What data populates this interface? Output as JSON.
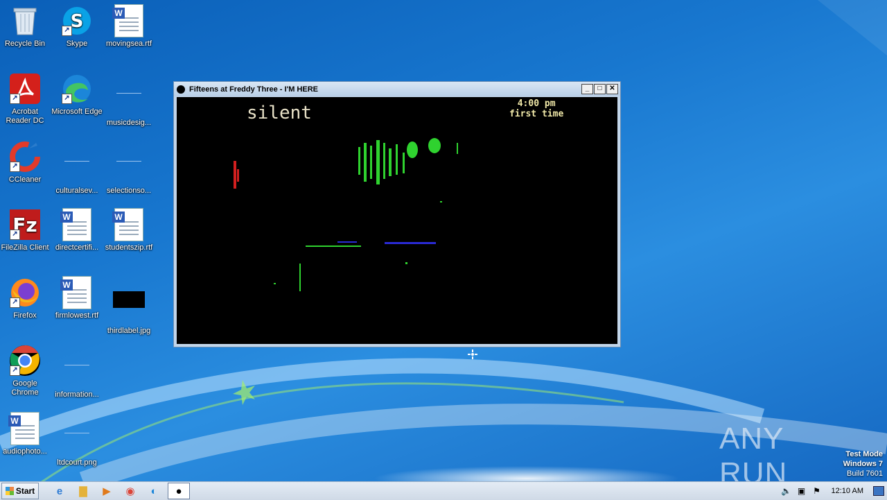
{
  "desktop": {
    "icons": [
      {
        "label": "Recycle Bin"
      },
      {
        "label": "Skype"
      },
      {
        "label": "movingsea.rtf"
      },
      {
        "label": "Acrobat Reader DC"
      },
      {
        "label": "Microsoft Edge"
      },
      {
        "label": "musicdesig..."
      },
      {
        "label": "CCleaner"
      },
      {
        "label": "culturalsev..."
      },
      {
        "label": "selectionso..."
      },
      {
        "label": "FileZilla Client"
      },
      {
        "label": "directcertifi..."
      },
      {
        "label": "studentszip.rtf"
      },
      {
        "label": "Firefox"
      },
      {
        "label": "firmlowest.rtf"
      },
      {
        "label": "thirdlabel.jpg"
      },
      {
        "label": "Google Chrome"
      },
      {
        "label": "information..."
      },
      {
        "label": "audiophoto..."
      },
      {
        "label": "ltdcourt.png"
      }
    ]
  },
  "window": {
    "title": "Fifteens at Freddy Three - I'M HERE",
    "game": {
      "status_text": "silent",
      "clock_time": "4:00 pm",
      "clock_sub": "first time"
    }
  },
  "watermark": {
    "text": "ANY RUN"
  },
  "testmode": {
    "line1": "Test Mode",
    "line2": "Windows 7",
    "line3": "Build 7601"
  },
  "taskbar": {
    "start_label": "Start",
    "clock": "12:10 AM"
  },
  "colors": {
    "accent": "#1877cf",
    "taskbar": "#dbe3ee"
  }
}
